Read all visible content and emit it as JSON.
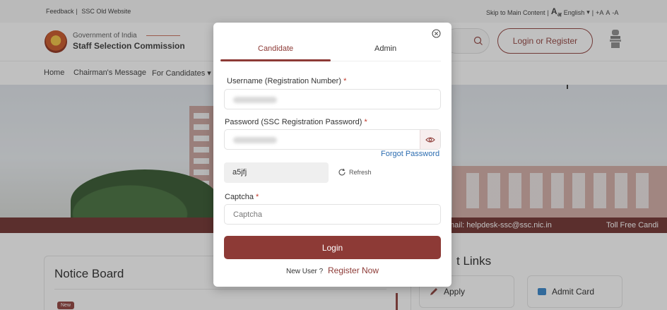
{
  "topbar": {
    "feedback": "Feedback",
    "separator": "|",
    "old_site": "SSC Old Website",
    "skip": "Skip to Main Content",
    "lang_glyph": "A",
    "lang_glyph_sub": "अ",
    "language": "English",
    "font_plus": "+A",
    "font_normal": "A",
    "font_minus": "-A"
  },
  "header": {
    "org_sub": "Government of India",
    "org_title": "Staff Selection Commission",
    "login_register": "Login or Register"
  },
  "nav": {
    "items": [
      "Home",
      "Chairman's Message",
      "For Candidates ▾"
    ]
  },
  "ticker": {
    "email": "mail: helpdesk-ssc@ssc.nic.in",
    "toll": "Toll Free Candi"
  },
  "notice": {
    "title": "Notice Board",
    "badge": "New"
  },
  "quick_links": {
    "title": "t Links",
    "apply": "Apply",
    "admit_card": "Admit Card"
  },
  "modal": {
    "tabs": [
      "Candidate",
      "Admin"
    ],
    "active_tab": "Candidate",
    "username_label": "Username (Registration Number)",
    "password_label": "Password (SSC Registration Password)",
    "required_mark": "*",
    "forgot": "Forgot Password",
    "captcha_value": "a5jfj",
    "refresh": "Refresh",
    "captcha_label": "Captcha",
    "captcha_placeholder": "Captcha",
    "login": "Login",
    "new_user": "New User ?",
    "register": "Register Now"
  },
  "colors": {
    "accent": "#8d3a36",
    "link": "#2b6cb0",
    "ticker": "#6b2a27"
  },
  "icons": [
    "search-icon",
    "eye-icon",
    "refresh-icon",
    "close-icon",
    "pencil-icon",
    "card-icon"
  ]
}
